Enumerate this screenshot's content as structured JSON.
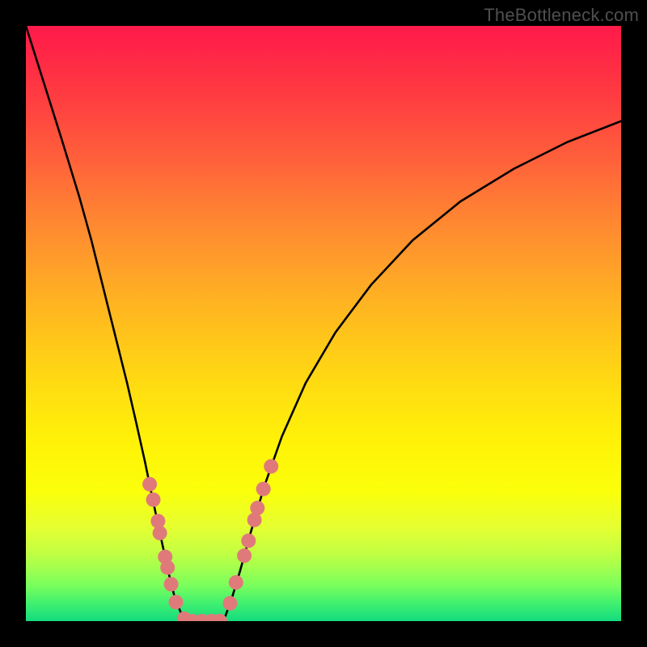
{
  "watermark": "TheBottleneck.com",
  "colors": {
    "frame": "#000000",
    "curve": "#000000",
    "dot": "#e07a7a",
    "gradient_top": "#ff1a4a",
    "gradient_bottom": "#14db7e"
  },
  "chart_data": {
    "type": "line",
    "title": "",
    "xlabel": "",
    "ylabel": "",
    "xlim": [
      0,
      1
    ],
    "ylim": [
      0,
      1
    ],
    "note": "No axis ticks or numeric labels are visible; values are normalized [0,1] estimates from pixel positions. y measured from bottom (0=bottom green band, 1=top red band).",
    "series": [
      {
        "name": "left-branch",
        "x": [
          0.0,
          0.03,
          0.06,
          0.09,
          0.11,
          0.13,
          0.15,
          0.17,
          0.185,
          0.2,
          0.213,
          0.228,
          0.24,
          0.25,
          0.26,
          0.272
        ],
        "y": [
          1.0,
          0.905,
          0.81,
          0.712,
          0.64,
          0.56,
          0.48,
          0.4,
          0.335,
          0.268,
          0.205,
          0.135,
          0.08,
          0.04,
          0.015,
          0.0
        ]
      },
      {
        "name": "floor",
        "x": [
          0.272,
          0.285,
          0.3,
          0.315,
          0.332
        ],
        "y": [
          0.0,
          0.0,
          0.0,
          0.0,
          0.0
        ]
      },
      {
        "name": "right-branch",
        "x": [
          0.332,
          0.345,
          0.36,
          0.378,
          0.4,
          0.43,
          0.47,
          0.52,
          0.58,
          0.65,
          0.73,
          0.82,
          0.91,
          1.0
        ],
        "y": [
          0.0,
          0.035,
          0.085,
          0.15,
          0.225,
          0.31,
          0.4,
          0.485,
          0.565,
          0.64,
          0.705,
          0.76,
          0.805,
          0.84
        ]
      }
    ],
    "scatter": {
      "name": "highlighted-points",
      "points": [
        {
          "x": 0.208,
          "y": 0.23
        },
        {
          "x": 0.214,
          "y": 0.204
        },
        {
          "x": 0.222,
          "y": 0.168
        },
        {
          "x": 0.225,
          "y": 0.148
        },
        {
          "x": 0.234,
          "y": 0.108
        },
        {
          "x": 0.238,
          "y": 0.09
        },
        {
          "x": 0.244,
          "y": 0.062
        },
        {
          "x": 0.252,
          "y": 0.032
        },
        {
          "x": 0.266,
          "y": 0.004
        },
        {
          "x": 0.28,
          "y": 0.0
        },
        {
          "x": 0.296,
          "y": 0.0
        },
        {
          "x": 0.312,
          "y": 0.0
        },
        {
          "x": 0.326,
          "y": 0.0
        },
        {
          "x": 0.343,
          "y": 0.03
        },
        {
          "x": 0.353,
          "y": 0.065
        },
        {
          "x": 0.367,
          "y": 0.11
        },
        {
          "x": 0.374,
          "y": 0.135
        },
        {
          "x": 0.384,
          "y": 0.17
        },
        {
          "x": 0.389,
          "y": 0.19
        },
        {
          "x": 0.399,
          "y": 0.222
        },
        {
          "x": 0.412,
          "y": 0.26
        }
      ]
    }
  }
}
